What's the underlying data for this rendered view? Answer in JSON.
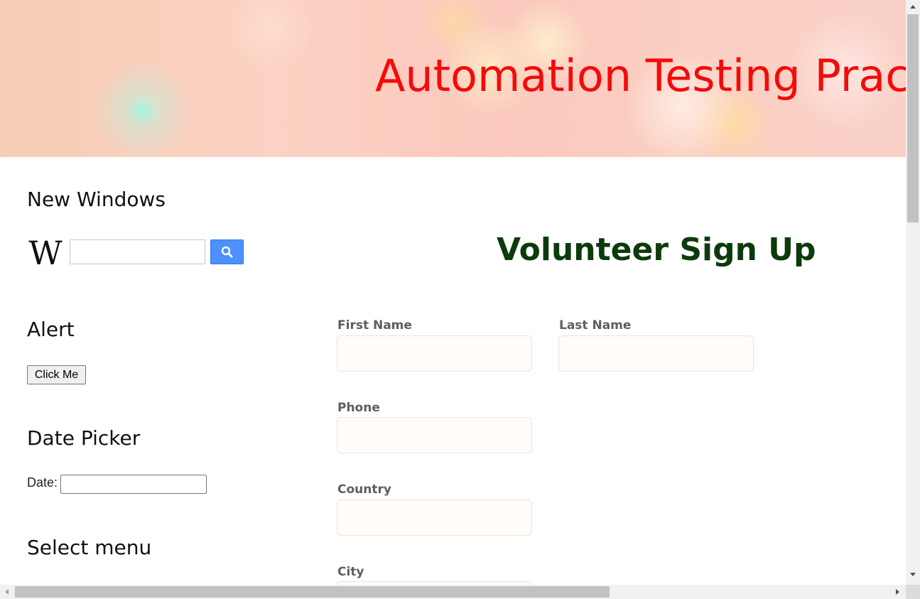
{
  "header": {
    "title": "Automation Testing Practice"
  },
  "new_windows": {
    "heading": "New Windows",
    "wiki_logo": "wikipedia-icon",
    "search_icon": "search-icon",
    "search_value": ""
  },
  "alert": {
    "heading": "Alert",
    "button_label": "Click Me"
  },
  "date_picker": {
    "heading": "Date Picker",
    "label": "Date:",
    "value": ""
  },
  "select_menu": {
    "heading": "Select menu"
  },
  "form": {
    "title": "Volunteer Sign Up",
    "fields": {
      "first_name": "First Name",
      "last_name": "Last Name",
      "phone": "Phone",
      "country": "Country",
      "city": "City"
    }
  },
  "colors": {
    "header_title": "#f50a0a",
    "form_title": "#0c3a0c",
    "search_button": "#4d90fe"
  }
}
